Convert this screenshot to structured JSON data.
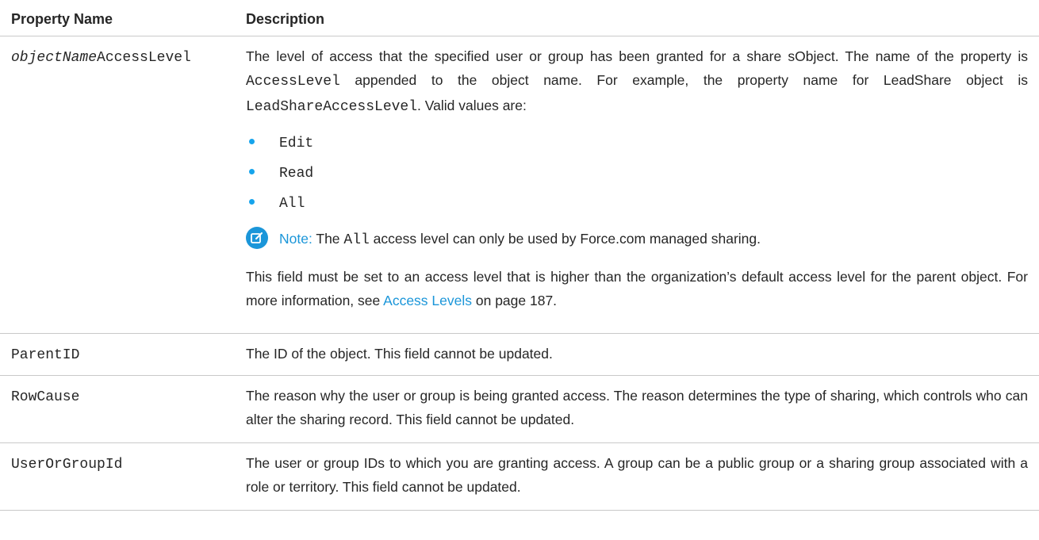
{
  "table": {
    "headers": {
      "property": "Property Name",
      "description": "Description"
    },
    "row1": {
      "property_italic": "objectName",
      "property_suffix": "AccessLevel",
      "desc_part1": "The level of access that the specified user or group has been granted for a share sObject. The name of the property is ",
      "desc_code1": "AccessLevel",
      "desc_part2": " appended to the object name. For example, the property name for LeadShare object is ",
      "desc_code2": "LeadShareAccessLevel",
      "desc_part3": ". Valid values are:",
      "values": [
        "Edit",
        "Read",
        "All"
      ],
      "note_label": "Note:",
      "note_pre": " The ",
      "note_code": "All",
      "note_post": " access level can only be used by Force.com managed sharing.",
      "para2_pre": "This field must be set to an access level that is higher than the organization’s default access level for the parent object. For more information, see ",
      "para2_link": "Access Levels",
      "para2_post": " on page 187."
    },
    "row2": {
      "property": "ParentID",
      "description": "The ID of the object. This field cannot be updated."
    },
    "row3": {
      "property": "RowCause",
      "description": "The reason why the user or group is being granted access. The reason determines the type of sharing, which controls who can alter the sharing record. This field cannot be updated."
    },
    "row4": {
      "property": "UserOrGroupId",
      "description": "The user or group IDs to which you are granting access. A group can be a public group or a sharing group associated with a role or territory. This field cannot be updated."
    }
  },
  "colors": {
    "accent": "#1b96d9",
    "bullet": "#16a4ec",
    "text": "#262626",
    "rule": "#c9c9c9"
  },
  "icons": {
    "note": "edit-note-icon",
    "bullet": "bullet-dot-icon"
  }
}
